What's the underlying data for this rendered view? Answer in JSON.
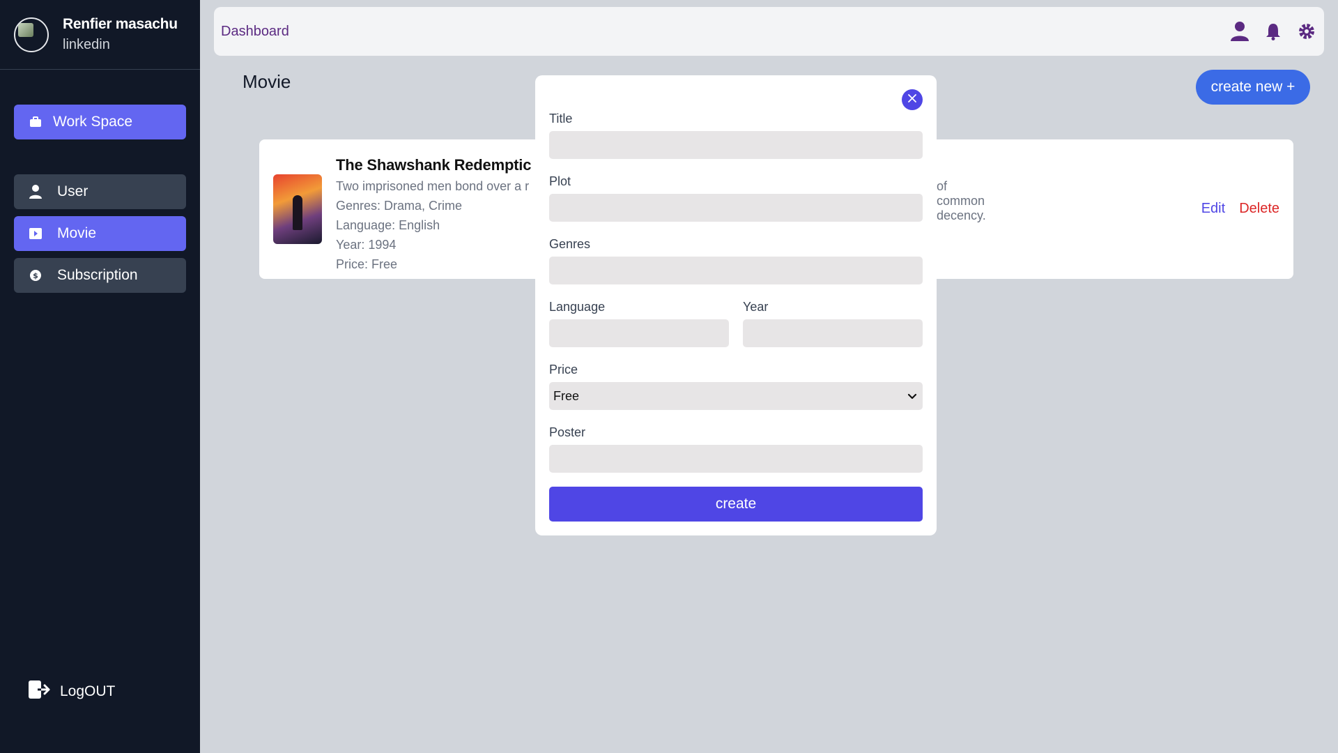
{
  "sidebar": {
    "profile_name": "Renfier masachu",
    "profile_sub": "linkedin",
    "workspace_label": "Work Space",
    "items": [
      {
        "label": "User",
        "icon": "user-icon"
      },
      {
        "label": "Movie",
        "icon": "play-icon",
        "active": true
      },
      {
        "label": "Subscription",
        "icon": "dollar-icon"
      }
    ],
    "logout_label": "LogOUT"
  },
  "header": {
    "breadcrumb": "Dashboard",
    "icons": [
      "user-icon",
      "bell-icon",
      "gear-icon"
    ]
  },
  "main": {
    "title": "Movie",
    "create_new_label": "create new +",
    "movie": {
      "title": "The Shawshank Redemptic",
      "plot_visible_start": "Two imprisoned men bond over a r",
      "plot_visible_end": "of common decency.",
      "genres": "Genres: Drama, Crime",
      "language": "Language: English",
      "year": "Year: 1994",
      "price": "Price: Free",
      "edit_label": "Edit",
      "delete_label": "Delete"
    }
  },
  "modal": {
    "title_label": "Title",
    "plot_label": "Plot",
    "genres_label": "Genres",
    "language_label": "Language",
    "year_label": "Year",
    "price_label": "Price",
    "price_selected": "Free",
    "poster_label": "Poster",
    "submit_label": "create"
  },
  "colors": {
    "sidebar_bg": "#111827",
    "accent": "#6366f1",
    "primary_button": "#4f46e5",
    "create_new": "#3b6be6",
    "danger": "#dc2626",
    "page_bg": "#d1d5db"
  }
}
